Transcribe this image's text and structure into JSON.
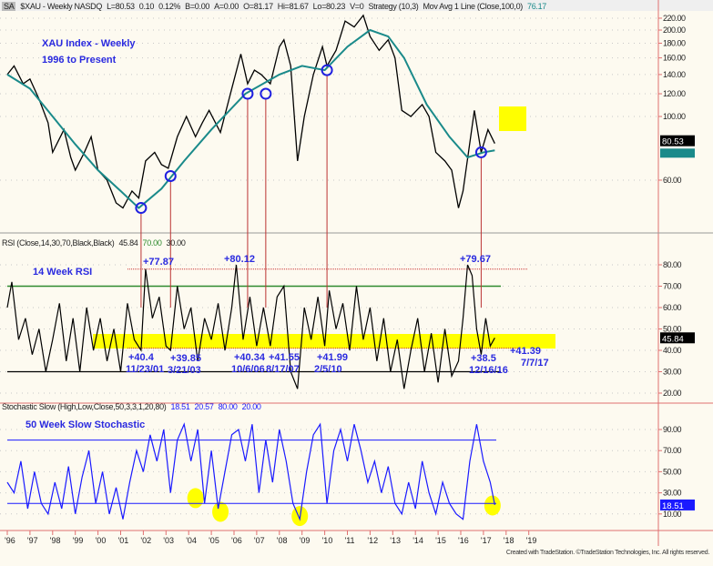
{
  "header": {
    "symbol_badge": "SA",
    "title": "$XAU - Weekly NASDQ",
    "last": "L=80.53",
    "chg": "0.10",
    "pct": "0.12%",
    "bid": "B=0.00",
    "ask": "A=0.00",
    "open": "O=81.17",
    "high": "Hi=81.67",
    "low": "Lo=80.23",
    "vol": "V=0",
    "strategy": "Strategy (10,3)",
    "ma_label": "Mov Avg 1 Line (Close,100,0)",
    "ma_value": "76.17"
  },
  "rsi_header": {
    "label": "RSI (Close,14,30,70,Black,Black)",
    "value": "45.84",
    "ob": "70.00",
    "os": "30.00"
  },
  "stoch_header": {
    "label": "Stochastic Slow (High,Low,Close,50,3,3,1,20,80)",
    "k": "18.51",
    "d": "20.57",
    "ob": "80.00",
    "os": "20.00"
  },
  "credit": "Created with TradeStation. ©TradeStation Technologies, Inc. All rights reserved.",
  "colors": {
    "price": "#000000",
    "ma": "#1a8a8a",
    "rsi_ob": "#2e8b2e",
    "annot": "#2a2adf",
    "stoch": "#1a1aff",
    "highlight": "#ffff00",
    "grid": "#c8c8c8",
    "axis": "#e07070"
  },
  "chart_data": [
    {
      "type": "line",
      "title": "XAU Index - Weekly",
      "subtitle": "1996 to Present",
      "scale": "log",
      "ylim": [
        40,
        240
      ],
      "yticks": [
        "220.00",
        "200.00",
        "180.00",
        "160.00",
        "140.00",
        "120.00",
        "100.00",
        "60.00"
      ],
      "ytick_values": [
        220,
        200,
        180,
        160,
        140,
        120,
        100,
        60
      ],
      "last_price": "80.53",
      "ma_last": "76.17",
      "x": [
        1996.0,
        1996.3,
        1996.7,
        1997.0,
        1997.4,
        1997.8,
        1998.0,
        1998.5,
        1998.8,
        1999.0,
        1999.4,
        1999.7,
        2000.0,
        2000.4,
        2000.8,
        2001.1,
        2001.5,
        2001.8,
        2002.1,
        2002.5,
        2002.8,
        2003.1,
        2003.5,
        2003.9,
        2004.3,
        2004.6,
        2004.9,
        2005.4,
        2005.9,
        2006.3,
        2006.6,
        2006.9,
        2007.2,
        2007.6,
        2008.0,
        2008.2,
        2008.5,
        2008.8,
        2009.1,
        2009.5,
        2009.9,
        2010.1,
        2010.5,
        2010.9,
        2011.3,
        2011.7,
        2012.0,
        2012.4,
        2012.8,
        2013.1,
        2013.4,
        2013.8,
        2014.3,
        2014.6,
        2014.9,
        2015.3,
        2015.6,
        2015.9,
        2016.1,
        2016.6,
        2016.9,
        2017.2,
        2017.5
      ],
      "series": [
        {
          "name": "$XAU",
          "values": [
            140,
            150,
            130,
            135,
            115,
            95,
            75,
            90,
            72,
            65,
            75,
            85,
            65,
            60,
            50,
            48,
            55,
            52,
            70,
            75,
            68,
            66,
            85,
            100,
            85,
            95,
            105,
            88,
            125,
            165,
            130,
            145,
            140,
            130,
            175,
            185,
            150,
            70,
            100,
            140,
            175,
            150,
            170,
            215,
            205,
            225,
            190,
            170,
            185,
            160,
            105,
            100,
            110,
            100,
            75,
            70,
            65,
            48,
            55,
            105,
            75,
            90,
            80.53
          ]
        },
        {
          "name": "Mov Avg 100",
          "x": [
            1996.0,
            1997.0,
            1998.0,
            1999.0,
            2000.0,
            2001.0,
            2001.8,
            2002.8,
            2003.8,
            2005.0,
            2006.5,
            2008.0,
            2009.0,
            2010.0,
            2011.0,
            2012.0,
            2012.8,
            2013.5,
            2014.5,
            2015.5,
            2016.3,
            2017.0,
            2017.5
          ],
          "values": [
            140,
            125,
            100,
            80,
            65,
            55,
            48,
            56,
            70,
            90,
            120,
            140,
            150,
            145,
            175,
            200,
            190,
            160,
            110,
            85,
            72,
            75,
            76.17
          ]
        }
      ],
      "markers": [
        {
          "x": 2001.9,
          "y": 48
        },
        {
          "x": 2003.2,
          "y": 62
        },
        {
          "x": 2006.6,
          "y": 120
        },
        {
          "x": 2007.4,
          "y": 120
        },
        {
          "x": 2010.1,
          "y": 145
        },
        {
          "x": 2016.9,
          "y": 75
        }
      ]
    },
    {
      "type": "line",
      "title": "14 Week RSI",
      "ylim": [
        15,
        85
      ],
      "yticks": [
        "80.00",
        "70.00",
        "60.00",
        "50.00",
        "40.00",
        "30.00",
        "20.00"
      ],
      "ytick_values": [
        80,
        70,
        60,
        50,
        40,
        30,
        20
      ],
      "last_value": "45.84",
      "x": [
        1996.0,
        1996.2,
        1996.5,
        1996.8,
        1997.1,
        1997.4,
        1997.7,
        1998.0,
        1998.3,
        1998.6,
        1998.9,
        1999.2,
        1999.5,
        1999.8,
        2000.1,
        2000.4,
        2000.7,
        2001.0,
        2001.3,
        2001.6,
        2001.9,
        2002.1,
        2002.4,
        2002.7,
        2003.0,
        2003.2,
        2003.5,
        2003.8,
        2004.1,
        2004.4,
        2004.7,
        2005.0,
        2005.3,
        2005.6,
        2005.9,
        2006.1,
        2006.4,
        2006.7,
        2007.0,
        2007.3,
        2007.6,
        2007.9,
        2008.2,
        2008.5,
        2008.8,
        2009.1,
        2009.4,
        2009.7,
        2010.0,
        2010.2,
        2010.5,
        2010.8,
        2011.1,
        2011.4,
        2011.7,
        2012.0,
        2012.3,
        2012.6,
        2012.9,
        2013.2,
        2013.5,
        2013.8,
        2014.1,
        2014.4,
        2014.7,
        2015.0,
        2015.3,
        2015.6,
        2015.9,
        2016.1,
        2016.3,
        2016.5,
        2016.7,
        2016.9,
        2017.1,
        2017.3,
        2017.5
      ],
      "values": [
        60,
        72,
        45,
        55,
        38,
        50,
        30,
        45,
        62,
        35,
        55,
        30,
        60,
        40,
        55,
        35,
        50,
        30,
        62,
        45,
        40,
        78,
        55,
        65,
        42,
        40,
        70,
        50,
        60,
        35,
        55,
        45,
        62,
        40,
        60,
        80,
        45,
        65,
        42,
        60,
        42,
        65,
        70,
        30,
        22,
        60,
        45,
        65,
        42,
        68,
        50,
        62,
        40,
        70,
        45,
        60,
        35,
        55,
        30,
        45,
        22,
        40,
        55,
        30,
        48,
        25,
        50,
        28,
        35,
        55,
        80,
        75,
        50,
        38,
        55,
        42,
        45.84
      ],
      "threshold_lines": [
        70,
        30,
        78
      ],
      "annotations": [
        {
          "label": "+77.87"
        },
        {
          "label": "+80.12"
        },
        {
          "label": "+79.67"
        },
        {
          "label": "+40.4",
          "date": "11/23/01"
        },
        {
          "label": "+39.85",
          "date": "3/21/03"
        },
        {
          "label": "+40.34",
          "date": "10/6/06"
        },
        {
          "label": "+41.55",
          "date": "8/17/07"
        },
        {
          "label": "+41.99",
          "date": "2/5/10"
        },
        {
          "label": "+38.5",
          "date": "12/16/16"
        },
        {
          "label": "+41.39",
          "date": "7/7/17"
        }
      ]
    },
    {
      "type": "line",
      "title": "50 Week Slow Stochastic",
      "ylim": [
        0,
        100
      ],
      "yticks": [
        "90.00",
        "70.00",
        "50.00",
        "30.00",
        "10.00"
      ],
      "ytick_values": [
        90,
        70,
        50,
        30,
        10
      ],
      "last_value": "18.51",
      "x": [
        1996.0,
        1996.3,
        1996.6,
        1996.9,
        1997.2,
        1997.5,
        1997.8,
        1998.1,
        1998.4,
        1998.7,
        1999.0,
        1999.3,
        1999.6,
        1999.9,
        2000.2,
        2000.5,
        2000.8,
        2001.1,
        2001.4,
        2001.7,
        2002.0,
        2002.3,
        2002.6,
        2002.9,
        2003.2,
        2003.5,
        2003.8,
        2004.1,
        2004.4,
        2004.7,
        2005.0,
        2005.3,
        2005.6,
        2005.9,
        2006.2,
        2006.5,
        2006.8,
        2007.1,
        2007.4,
        2007.7,
        2008.0,
        2008.3,
        2008.6,
        2008.9,
        2009.2,
        2009.5,
        2009.8,
        2010.1,
        2010.4,
        2010.7,
        2011.0,
        2011.3,
        2011.6,
        2011.9,
        2012.2,
        2012.5,
        2012.8,
        2013.1,
        2013.4,
        2013.7,
        2014.0,
        2014.3,
        2014.6,
        2014.9,
        2015.2,
        2015.5,
        2015.8,
        2016.1,
        2016.4,
        2016.7,
        2017.0,
        2017.3,
        2017.5
      ],
      "values": [
        40,
        30,
        60,
        15,
        50,
        20,
        10,
        40,
        15,
        55,
        10,
        45,
        70,
        20,
        50,
        10,
        35,
        5,
        40,
        70,
        50,
        85,
        60,
        90,
        30,
        80,
        95,
        60,
        90,
        20,
        70,
        15,
        50,
        85,
        90,
        60,
        95,
        30,
        80,
        40,
        90,
        60,
        20,
        5,
        50,
        85,
        95,
        20,
        70,
        90,
        60,
        95,
        70,
        40,
        60,
        30,
        55,
        20,
        10,
        40,
        15,
        60,
        30,
        10,
        40,
        20,
        10,
        5,
        60,
        95,
        60,
        40,
        18.51
      ]
    }
  ]
}
